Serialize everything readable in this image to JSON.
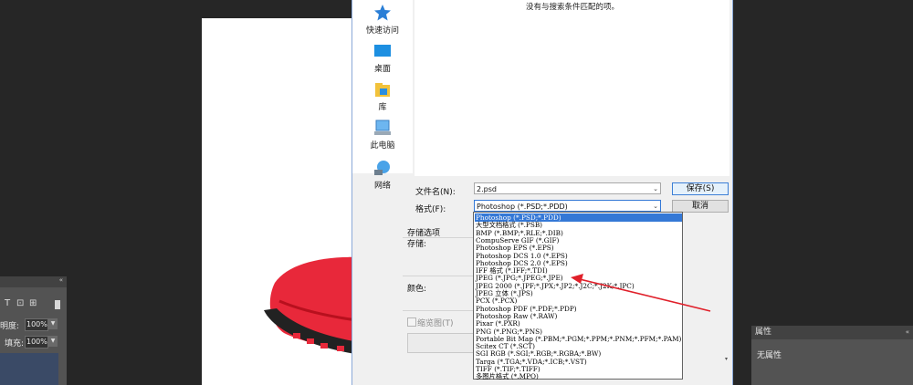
{
  "workspace": {
    "left_panel": {
      "opacity_label": "明度:",
      "opacity_value": "100%",
      "fill_label": "填充:",
      "fill_value": "100%",
      "tools": [
        "T",
        "⊡",
        "⊞",
        "🔒"
      ]
    },
    "right_panel": {
      "tab_label": "属性",
      "body_text": "无属性"
    }
  },
  "dialog": {
    "places": [
      {
        "label": "快速访问",
        "icon": "star-icon"
      },
      {
        "label": "桌面",
        "icon": "desktop-icon"
      },
      {
        "label": "库",
        "icon": "library-icon"
      },
      {
        "label": "此电脑",
        "icon": "computer-icon"
      },
      {
        "label": "网络",
        "icon": "network-icon"
      }
    ],
    "empty_message": "没有与搜索条件匹配的项。",
    "filename_label": "文件名(N):",
    "filename_value": "2.psd",
    "format_label": "格式(F):",
    "format_value": "Photoshop (*.PSD;*.PDD)",
    "save_button": "保存(S)",
    "cancel_button": "取消",
    "options_title": "存储选项",
    "store_label": "存储:",
    "color_label": "颜色:",
    "thumbnail_label": "缩览图(T)",
    "format_options": [
      "Photoshop (*.PSD;*.PDD)",
      "大型文档格式 (*.PSB)",
      "BMP (*.BMP;*.RLE;*.DIB)",
      "CompuServe GIF (*.GIF)",
      "Photoshop EPS (*.EPS)",
      "Photoshop DCS 1.0 (*.EPS)",
      "Photoshop DCS 2.0 (*.EPS)",
      "IFF 格式 (*.IFF;*.TDI)",
      "JPEG (*.JPG;*.JPEG;*.JPE)",
      "JPEG 2000 (*.JPF;*.JPX;*.JP2;*.J2C;*.J2K;*.JPC)",
      "JPEG 立体 (*.JPS)",
      "PCX (*.PCX)",
      "Photoshop PDF (*.PDF;*.PDP)",
      "Photoshop Raw (*.RAW)",
      "Pixar (*.PXR)",
      "PNG (*.PNG;*.PNS)",
      "Portable Bit Map (*.PBM;*.PGM;*.PPM;*.PNM;*.PFM;*.PAM)",
      "Scitex CT (*.SCT)",
      "SGI RGB (*.SGI;*.RGB;*.RGBA;*.BW)",
      "Targa (*.TGA;*.VDA;*.ICB;*.VST)",
      "TIFF (*.TIF;*.TIFF)",
      "多图片格式 (*.MPO)"
    ]
  },
  "colors": {
    "accent": "#3478d6",
    "annotation_arrow": "#e0202a",
    "workspace_bg": "#262626"
  }
}
